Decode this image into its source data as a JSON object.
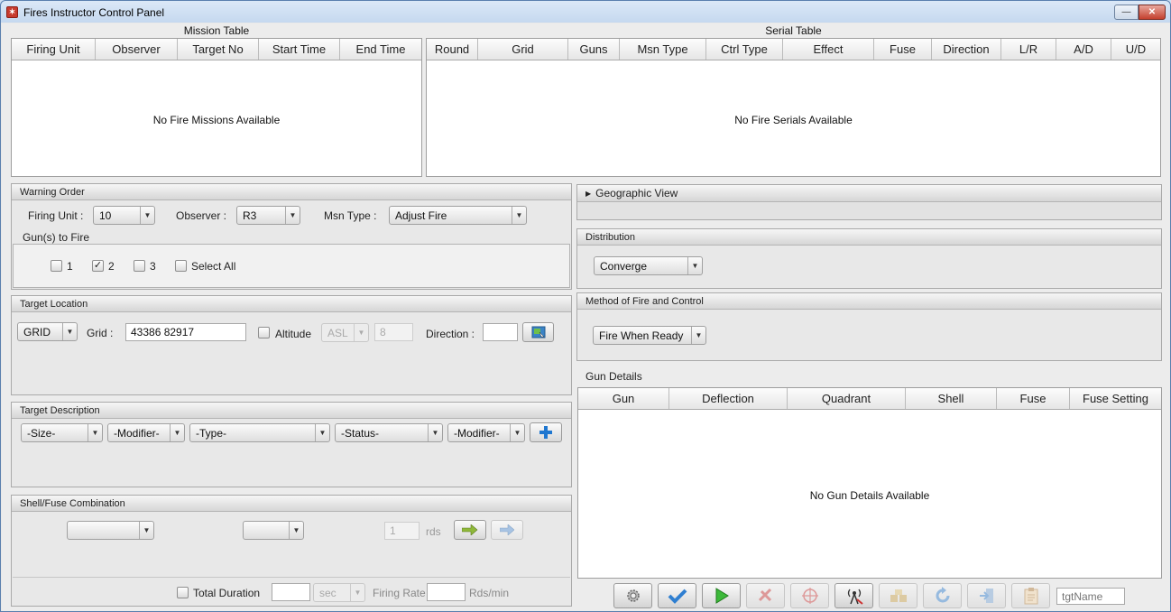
{
  "window": {
    "title": "Fires Instructor Control Panel",
    "app_icon": "fires-app-icon",
    "buttons": {
      "minimize": "—",
      "close": "✕"
    }
  },
  "mission_table": {
    "label": "Mission Table",
    "columns": [
      "Firing Unit",
      "Observer",
      "Target No",
      "Start Time",
      "End Time"
    ],
    "empty_text": "No Fire Missions Available"
  },
  "serial_table": {
    "label": "Serial Table",
    "columns": [
      "Round",
      "Grid",
      "Guns",
      "Msn Type",
      "Ctrl Type",
      "Effect",
      "Fuse",
      "Direction",
      "L/R",
      "A/D",
      "U/D"
    ],
    "empty_text": "No Fire Serials Available"
  },
  "warning_order": {
    "title": "Warning Order",
    "firing_unit_label": "Firing Unit :",
    "firing_unit_value": "10",
    "observer_label": "Observer :",
    "observer_value": "R3",
    "msn_type_label": "Msn Type :",
    "msn_type_value": "Adjust Fire",
    "guns_label": "Gun(s) to Fire",
    "guns": [
      {
        "label": "1",
        "checked": false
      },
      {
        "label": "2",
        "checked": true
      },
      {
        "label": "3",
        "checked": false
      }
    ],
    "select_all_label": "Select All"
  },
  "target_location": {
    "title": "Target Location",
    "type_value": "GRID",
    "grid_label": "Grid :",
    "grid_value": "43386 82917",
    "altitude_label": "Altitude",
    "altitude_ref": "ASL",
    "altitude_value": "8",
    "direction_label": "Direction :",
    "direction_value": ""
  },
  "target_description": {
    "title": "Target Description",
    "size": "-Size-",
    "modifier1": "-Modifier-",
    "type": "-Type-",
    "status": "-Status-",
    "modifier2": "-Modifier-"
  },
  "shell_fuse": {
    "title": "Shell/Fuse Combination",
    "rounds_value": "1",
    "rounds_unit": "rds",
    "total_duration_label": "Total Duration",
    "duration_value": "",
    "duration_unit": "sec",
    "firing_rate_label": "Firing Rate",
    "firing_rate_value": "",
    "firing_rate_unit": "Rds/min"
  },
  "geographic_view": {
    "title": "Geographic View"
  },
  "distribution": {
    "title": "Distribution",
    "value": "Converge"
  },
  "method_of_fire": {
    "title": "Method of Fire and Control",
    "value": "Fire When Ready"
  },
  "gun_details": {
    "label": "Gun Details",
    "columns": [
      "Gun",
      "Deflection",
      "Quadrant",
      "Shell",
      "Fuse",
      "Fuse Setting"
    ],
    "empty_text": "No Gun Details Available"
  },
  "toolbar": {
    "target_name_placeholder": "tgtName"
  }
}
